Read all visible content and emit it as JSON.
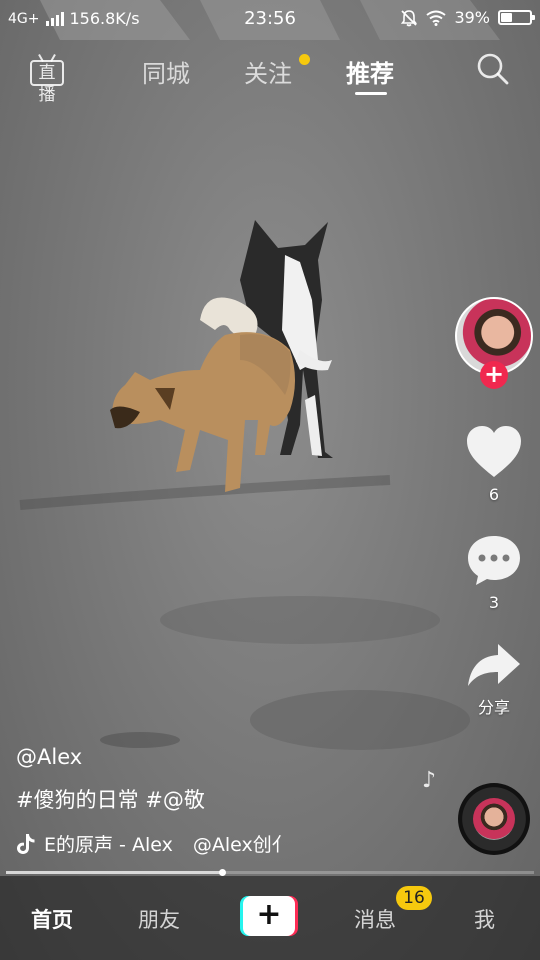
{
  "status_bar": {
    "network": "4G+",
    "speed": "156.8K/s",
    "time": "23:56",
    "battery": "39%",
    "battery_level": 0.39
  },
  "top_nav": {
    "live_label": "直播",
    "tabs": [
      {
        "label": "同城"
      },
      {
        "label": "关注"
      },
      {
        "label": "推荐"
      }
    ],
    "active_tab": "推荐"
  },
  "right_rail": {
    "likes": "6",
    "comments": "3",
    "share_label": "分享"
  },
  "video": {
    "author": "@Alex",
    "caption": "#傻狗的日常 #@敬",
    "music_text": "E的原声 - Alex",
    "music_creator": "@Alex创亻",
    "progress": 0.41
  },
  "bottom_nav": {
    "items": [
      {
        "label": "首页"
      },
      {
        "label": "朋友"
      },
      {
        "label": "消息"
      },
      {
        "label": "我"
      }
    ],
    "create_symbol": "+",
    "messages_badge": "16"
  },
  "colors": {
    "accent_red": "#fe2c55",
    "accent_cyan": "#25f4ee",
    "badge_yellow": "#f6c90e"
  }
}
